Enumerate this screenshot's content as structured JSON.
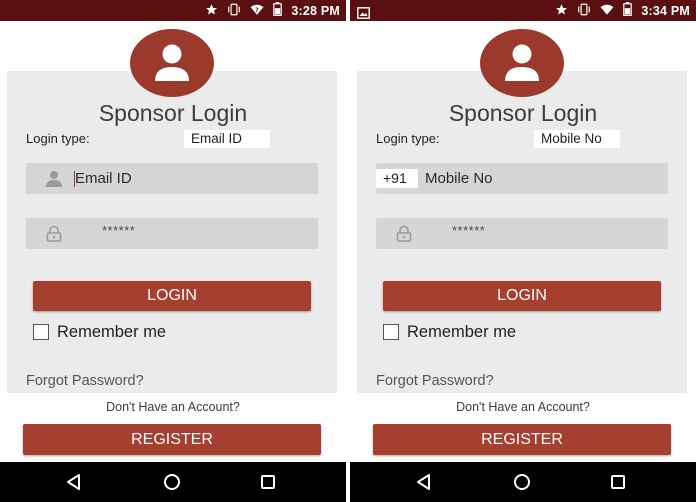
{
  "screens": [
    {
      "status": {
        "time": "3:28 PM"
      },
      "title": "Sponsor Login",
      "login_type_label": "Login type:",
      "login_type_value": "Email ID",
      "username_placeholder": "Email ID",
      "password_mask": "******",
      "login_button": "LOGIN",
      "remember_label": "Remember me",
      "forgot_link": "Forgot Password?",
      "no_account": "Don't Have an Account?",
      "register_button": "REGISTER"
    },
    {
      "status": {
        "time": "3:34 PM"
      },
      "title": "Sponsor Login",
      "login_type_label": "Login type:",
      "login_type_value": "Mobile No",
      "country_code": "+91",
      "username_placeholder": "Mobile No",
      "password_mask": "******",
      "login_button": "LOGIN",
      "remember_label": "Remember me",
      "forgot_link": "Forgot Password?",
      "no_account": "Don't Have an Account?",
      "register_button": "REGISTER"
    }
  ],
  "icons": {
    "status": [
      "star-icon",
      "vibrate-icon",
      "wifi-icon",
      "battery-icon"
    ],
    "left_status_extra": "data-saver-icon",
    "right_status_extra": "image-notification-icon",
    "avatar": "user-avatar-icon",
    "user_field": "user-icon",
    "password_field": "lock-icon",
    "nav": [
      "back-icon",
      "home-icon",
      "recents-icon"
    ]
  },
  "colors": {
    "status_bar": "#5a1010",
    "accent": "#a53f30",
    "card_bg": "#ebebeb",
    "field_bg": "#d6d6d6",
    "nav_bar": "#000000"
  }
}
